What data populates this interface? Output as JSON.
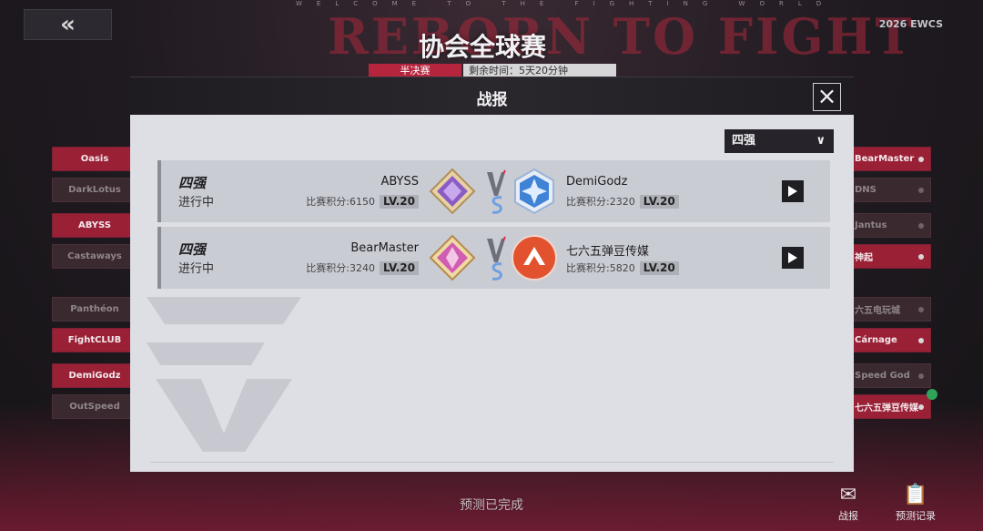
{
  "background": {
    "banner_word": "REBORN TO FIGHT",
    "welcome_text": "WELCOME TO THE FIGHTING WORLD"
  },
  "header": {
    "back_icon": "double-chevron-left-icon",
    "brand": "2026 EWCS",
    "event_title": "协会全球赛",
    "stage": "半决赛",
    "time_remaining": "剩余时间：5天20分钟"
  },
  "bracket": {
    "left_teams": [
      {
        "name": "Oasis",
        "state": "win"
      },
      {
        "name": "DarkLotus",
        "state": "lose"
      },
      {
        "name": "ABYSS",
        "state": "win"
      },
      {
        "name": "Castaways",
        "state": "lose"
      },
      {
        "name": "Panthéon",
        "state": "lose"
      },
      {
        "name": "FightCLUB",
        "state": "win"
      },
      {
        "name": "DemiGodz",
        "state": "win"
      },
      {
        "name": "OutSpeed",
        "state": "lose"
      }
    ],
    "right_teams": [
      {
        "name": "BearMaster",
        "state": "win"
      },
      {
        "name": "DNS",
        "state": "lose"
      },
      {
        "name": "Jantus",
        "state": "lose"
      },
      {
        "name": "神起",
        "state": "win"
      },
      {
        "name": "六五电玩城",
        "state": "lose"
      },
      {
        "name": "Cárnage",
        "state": "win"
      },
      {
        "name": "Speed God",
        "state": "lose"
      },
      {
        "name": "七六五弹豆传媒",
        "state": "win"
      }
    ]
  },
  "modal": {
    "title": "战报",
    "close_icon": "close-icon",
    "filter": {
      "selected": "四强",
      "icon": "chevron-down-icon"
    },
    "matches": [
      {
        "stage": "四强",
        "status": "进行中",
        "home": {
          "name": "ABYSS",
          "score_label": "比赛积分:6150",
          "level": "LV.20",
          "emblem_color": "#8a5cc4"
        },
        "away": {
          "name": "DemiGodz",
          "score_label": "比赛积分:2320",
          "level": "LV.20",
          "emblem_color": "#3f82d6"
        }
      },
      {
        "stage": "四强",
        "status": "进行中",
        "home": {
          "name": "BearMaster",
          "score_label": "比赛积分:3240",
          "level": "LV.20",
          "emblem_color": "#d15db3"
        },
        "away": {
          "name": "七六五弹豆传媒",
          "score_label": "比赛积分:5820",
          "level": "LV.20",
          "emblem_color": "#e2522e"
        }
      }
    ]
  },
  "footer": {
    "predict_status": "预测已完成",
    "mail_label": "战报",
    "record_label": "预测记录"
  }
}
